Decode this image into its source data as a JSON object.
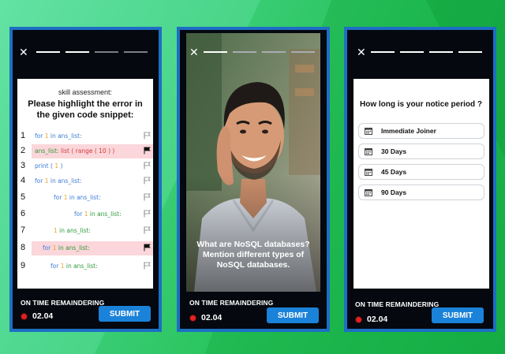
{
  "screens": [
    {
      "skill_label": "skill assessment:",
      "question": "Please highlight the error in the given code snippet:",
      "code_lines": [
        {
          "num": "1",
          "parts": [
            [
              "for ",
              "kw"
            ],
            [
              "1 ",
              "num"
            ],
            [
              "in ans_list:",
              "kw"
            ]
          ],
          "highlighted": false,
          "flag": "outline"
        },
        {
          "num": "2",
          "parts": [
            [
              "ans_list: ",
              "var"
            ],
            [
              "list ( range ( 10 ) )",
              "err"
            ]
          ],
          "highlighted": true,
          "flag": "filled"
        },
        {
          "num": "3",
          "parts": [
            [
              "print ( ",
              "kw"
            ],
            [
              "1",
              "num"
            ],
            [
              " )",
              "kw"
            ]
          ],
          "highlighted": false,
          "flag": "outline"
        },
        {
          "num": "4",
          "parts": [
            [
              "for ",
              "kw"
            ],
            [
              "1 ",
              "num"
            ],
            [
              "in ans_list:",
              "kw"
            ]
          ],
          "highlighted": false,
          "flag": "outline"
        },
        {
          "num": "5",
          "parts": [
            [
              "for ",
              "kw"
            ],
            [
              "1 ",
              "num"
            ],
            [
              "in ans_list:",
              "kw"
            ]
          ],
          "highlighted": false,
          "flag": "outline"
        },
        {
          "num": "6",
          "parts": [
            [
              "for ",
              "kw"
            ],
            [
              "1 ",
              "num"
            ],
            [
              "in ans_list:",
              "var"
            ]
          ],
          "highlighted": false,
          "flag": "outline"
        },
        {
          "num": "7",
          "parts": [
            [
              "1 ",
              "num"
            ],
            [
              "in ans_list:",
              "var"
            ]
          ],
          "highlighted": false,
          "flag": "outline"
        },
        {
          "num": "8",
          "parts": [
            [
              "for ",
              "kw"
            ],
            [
              "1 ",
              "num"
            ],
            [
              "in ans_list:",
              "var"
            ]
          ],
          "highlighted": true,
          "flag": "filled"
        },
        {
          "num": "9",
          "parts": [
            [
              "for ",
              "kw"
            ],
            [
              "1 ",
              "num"
            ],
            [
              "in ans_list:",
              "var"
            ]
          ],
          "highlighted": false,
          "flag": "outline"
        }
      ],
      "timer_label": "ON TIME REMAINDERING",
      "timer_value": "02.04",
      "submit_label": "SUBMIT",
      "progress": [
        true,
        true,
        false,
        false
      ]
    },
    {
      "question": "What are NoSQL databases? Mention different types of NoSQL databases.",
      "timer_label": "ON TIME REMAINDERING",
      "timer_value": "02.04",
      "submit_label": "SUBMIT",
      "progress": [
        true,
        false,
        false,
        false
      ]
    },
    {
      "question": "How long is your notice period ?",
      "options": [
        "Immediate Joiner",
        "30 Days",
        "45 Days",
        "90 Days"
      ],
      "timer_label": "ON TIME REMAINDERING",
      "timer_value": "02.04",
      "submit_label": "SUBMIT",
      "progress": [
        true,
        true,
        true,
        true
      ]
    }
  ],
  "icons": {
    "close": "close-icon",
    "flag": "flag-icon",
    "calendar": "calendar-icon",
    "record": "record-dot-icon"
  },
  "colors": {
    "accent": "#1b82d9",
    "phone_border": "#1d6fc4",
    "highlight": "#fbd6da",
    "record": "#e02222"
  }
}
